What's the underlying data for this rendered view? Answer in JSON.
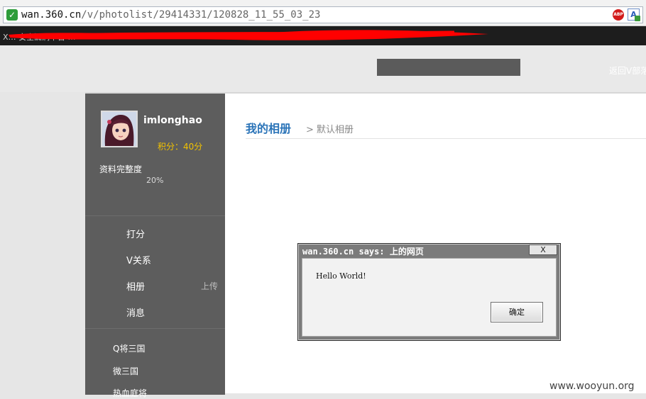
{
  "browser": {
    "url_host": "wan.360.cn",
    "url_path": "/v/photolist/29414331/120828_11_55_03_23",
    "bookmark_text": "X… 安全漏洞平台 …"
  },
  "top": {
    "back_link": "返回V部落"
  },
  "sidebar": {
    "username": "imlonghao",
    "score": "积分：40分",
    "profile_label": "资料完整度",
    "profile_pct": "20%",
    "nav": [
      "打分",
      "V关系",
      "相册",
      "消息"
    ],
    "upload_label": "上传",
    "games": [
      "Q将三国",
      "微三国",
      "热血庭将"
    ]
  },
  "content": {
    "title": "我的相册",
    "subtitle": "> 默认相册"
  },
  "dialog": {
    "title": "wan.360.cn says: 上的网页",
    "close_label": "X",
    "message": "Hello World!",
    "ok_label": "确定"
  },
  "watermark": "www.wooyun.org",
  "colors": {
    "accent_title": "#2b74b8",
    "score": "#f2c200",
    "sidebar_bg": "#5d5d5d"
  }
}
